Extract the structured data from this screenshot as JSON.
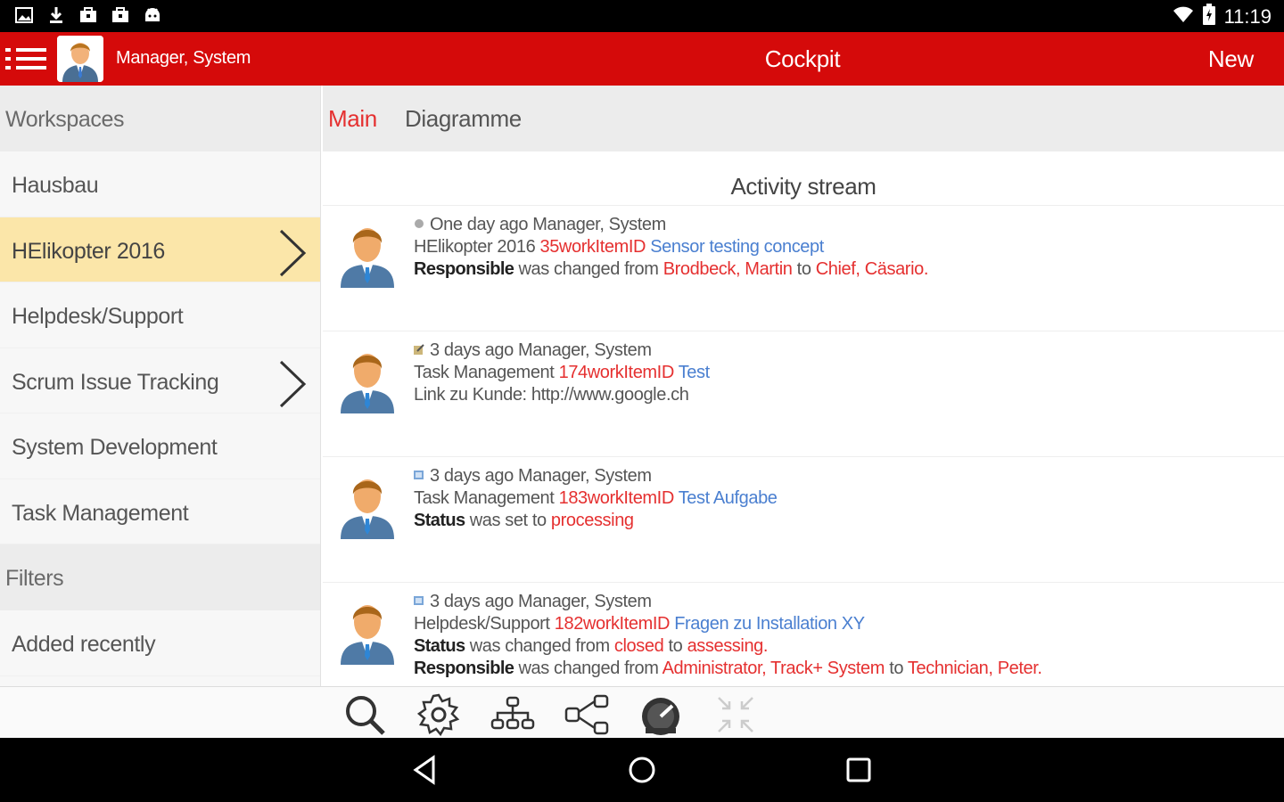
{
  "status_bar": {
    "time": "11:19",
    "icons": [
      "image-icon",
      "download-icon",
      "briefcase-icon",
      "briefcase-icon",
      "android-icon"
    ]
  },
  "app_bar": {
    "user_name": "Manager, System",
    "title": "Cockpit",
    "new_label": "New",
    "accent_color": "#d50a0a"
  },
  "sidebar": {
    "workspaces_header": "Workspaces",
    "items": [
      {
        "label": "Hausbau"
      },
      {
        "label": "HElikopter 2016"
      },
      {
        "label": "Helpdesk/Support"
      },
      {
        "label": "Scrum Issue Tracking"
      },
      {
        "label": "System Development"
      },
      {
        "label": "Task Management"
      }
    ],
    "filters_header": "Filters",
    "filter_items": [
      {
        "label": "Added recently"
      }
    ],
    "selected_color": "#fbe6a9"
  },
  "tabs": {
    "main": "Main",
    "diagramme": "Diagramme"
  },
  "stream": {
    "title": "Activity stream",
    "activities": [
      {
        "meta": "One day ago Manager, System",
        "project": "HElikopter 2016",
        "item_id": "35workItemID",
        "item_title": "Sensor testing concept",
        "field": "Responsible",
        "change_text": "was changed from",
        "from": "Brodbeck, Martin",
        "to_word": "to",
        "to": "Chief, Cäsario."
      },
      {
        "meta": "3 days ago Manager, System",
        "project": "Task Management",
        "item_id": "174workItemID",
        "item_title": "Test",
        "extra": "Link zu Kunde: http://www.google.ch"
      },
      {
        "meta": "3 days ago Manager, System",
        "project": "Task Management",
        "item_id": "183workItemID",
        "item_title": "Test Aufgabe",
        "field": "Status",
        "change_text": "was set to",
        "to": "processing"
      },
      {
        "meta": "3 days ago Manager, System",
        "project": "Helpdesk/Support",
        "item_id": "182workItemID",
        "item_title": "Fragen zu Installation XY",
        "field": "Status",
        "change_text": "was changed from",
        "from": "closed",
        "to_word": "to",
        "to": "assessing.",
        "field2": "Responsible",
        "change_text2": "was changed from",
        "from2": "Administrator, Track+ System",
        "to_word2": "to",
        "to2": "Technician, Peter."
      }
    ]
  },
  "toolbar": {
    "icons": [
      "search-icon",
      "gear-icon",
      "hierarchy-icon",
      "share-icon",
      "dashboard-icon",
      "collapse-icon"
    ]
  },
  "nav": {
    "icons": [
      "back-icon",
      "home-icon",
      "recents-icon"
    ]
  }
}
